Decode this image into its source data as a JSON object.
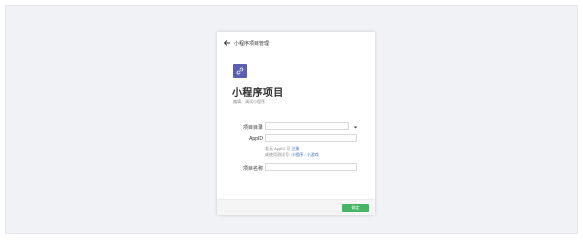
{
  "header": {
    "back_label": "小程序项目管理"
  },
  "project": {
    "icon": "link-icon",
    "icon_color": "#5b5fb4",
    "title": "小程序项目",
    "subtitle": "编辑、调试小程序"
  },
  "form": {
    "dir_label": "项目目录",
    "dir_value": "",
    "appid_label": "AppID",
    "appid_value": "",
    "hint_no_appid_prefix": "若无 AppID 可",
    "hint_register": "注册",
    "hint_try_prefix": "或使用测试号:",
    "hint_miniprogram": "小程序",
    "hint_separator": " / ",
    "hint_minigame": "小游戏",
    "name_label": "项目名称",
    "name_value": ""
  },
  "footer": {
    "confirm_label": "确定",
    "confirm_color": "#45b563"
  }
}
